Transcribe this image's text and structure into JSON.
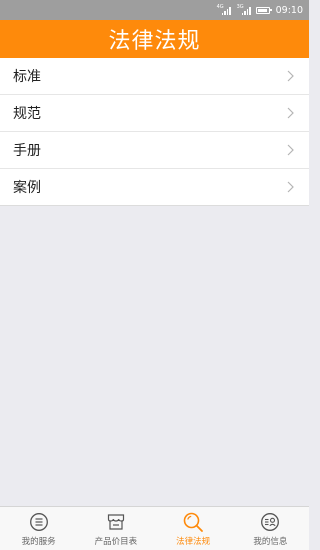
{
  "status_bar": {
    "signal1_tag": "4G",
    "signal2_tag": "3G",
    "time": "09:10"
  },
  "header": {
    "title": "法律法规"
  },
  "list": {
    "items": [
      {
        "label": "标准"
      },
      {
        "label": "规范"
      },
      {
        "label": "手册"
      },
      {
        "label": "案例"
      }
    ]
  },
  "tabbar": {
    "tabs": [
      {
        "label": "我的服务",
        "icon": "menu-circle-icon",
        "active": false
      },
      {
        "label": "产品价目表",
        "icon": "shop-icon",
        "active": false
      },
      {
        "label": "法律法规",
        "icon": "search-icon",
        "active": true
      },
      {
        "label": "我的信息",
        "icon": "user-list-icon",
        "active": false
      }
    ]
  },
  "colors": {
    "accent": "#fe8a0b",
    "status_bar": "#9e9e9e",
    "background": "#ebebf0"
  }
}
